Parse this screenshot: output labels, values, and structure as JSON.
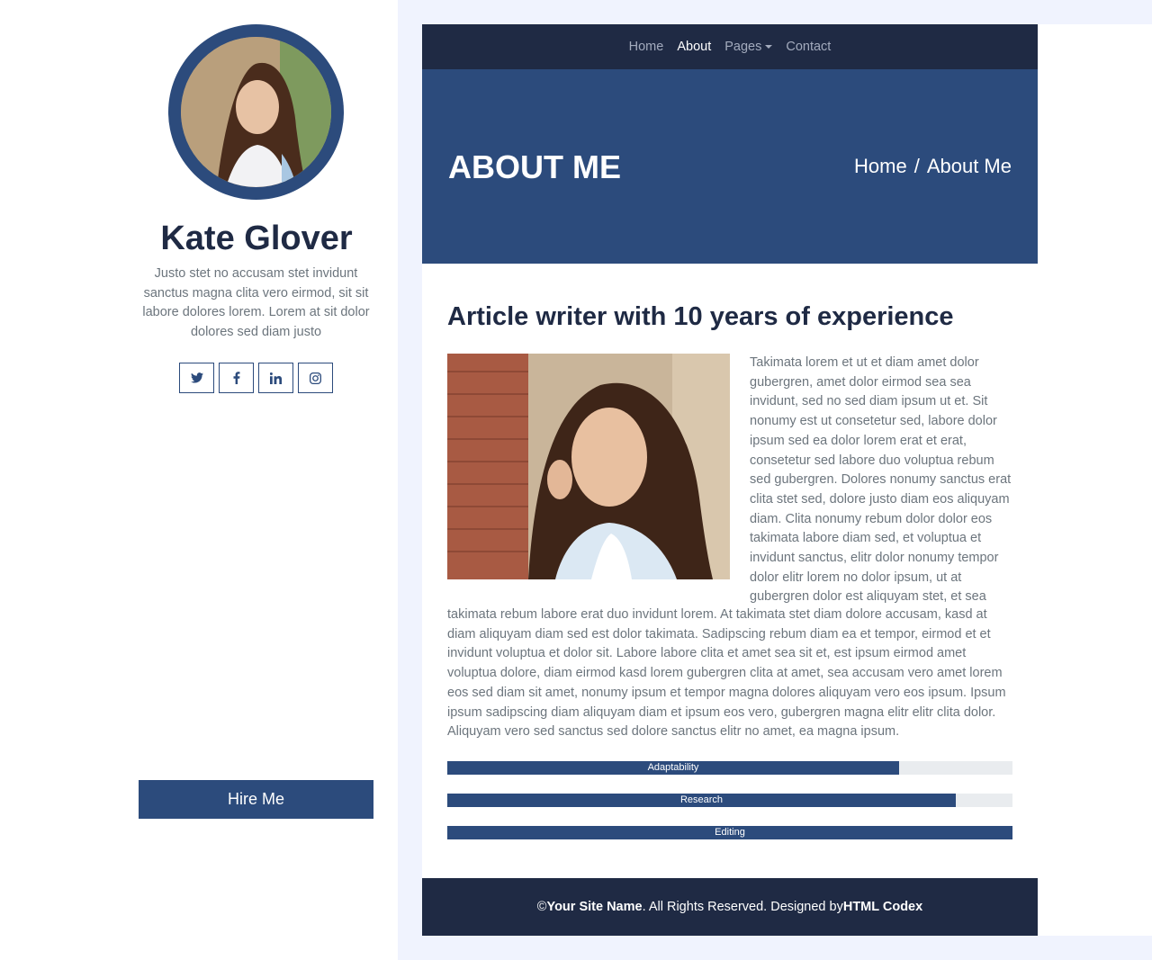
{
  "sidebar": {
    "name": "Kate Glover",
    "bio": "Justo stet no accusam stet invidunt sanctus magna clita vero eirmod, sit sit labore dolores lorem. Lorem at sit dolor dolores sed diam justo",
    "socials": [
      {
        "icon": "twitter-icon"
      },
      {
        "icon": "facebook-icon"
      },
      {
        "icon": "linkedin-icon"
      },
      {
        "icon": "instagram-icon"
      }
    ],
    "hire_label": "Hire Me"
  },
  "nav": {
    "items": [
      "Home",
      "About",
      "Pages",
      "Contact"
    ],
    "active": "About"
  },
  "hero": {
    "title": "ABOUT ME",
    "breadcrumb": [
      "Home",
      "/",
      "About Me"
    ]
  },
  "content": {
    "title": "Article writer with 10 years of experience",
    "para1": "Takimata lorem et ut et diam amet dolor gubergren, amet dolor eirmod sea sea invidunt, sed no sed diam ipsum ut et. Sit nonumy est ut consetetur sed, labore dolor ipsum sed ea dolor lorem erat et erat, consetetur sed labore duo voluptua rebum sed gubergren. Dolores nonumy sanctus erat clita stet sed, dolore justo diam eos aliquyam diam. Clita nonumy rebum dolor dolor eos takimata labore diam sed, et voluptua et invidunt sanctus, elitr dolor nonumy tempor dolor elitr lorem no dolor ipsum, ut at gubergren dolor est aliquyam stet, et sea",
    "para2": "takimata rebum labore erat duo invidunt lorem. At takimata stet diam dolore accusam, kasd at diam aliquyam diam sed est dolor takimata. Sadipscing rebum diam ea et tempor, eirmod et et invidunt voluptua et dolor sit. Labore labore clita et amet sea sit et, est ipsum eirmod amet voluptua dolore, diam eirmod kasd lorem gubergren clita at amet, sea accusam vero amet lorem eos sed diam sit amet, nonumy ipsum et tempor magna dolores aliquyam vero eos ipsum. Ipsum ipsum sadipscing diam aliquyam diam et ipsum eos vero, gubergren magna elitr elitr clita dolor. Aliquyam vero sed sanctus sed dolore sanctus elitr no amet, ea magna ipsum."
  },
  "skills": [
    {
      "label": "Adaptability",
      "percent": 80
    },
    {
      "label": "Research",
      "percent": 90
    },
    {
      "label": "Editing",
      "percent": 100
    }
  ],
  "footer": {
    "copyright": "©",
    "site_name": "Your Site Name",
    "rights_text": ". All Rights Reserved. Designed by",
    "designer": "HTML Codex"
  },
  "colors": {
    "primary": "#2c4b7c",
    "dark": "#1f2a44",
    "background": "#f0f3fe"
  }
}
